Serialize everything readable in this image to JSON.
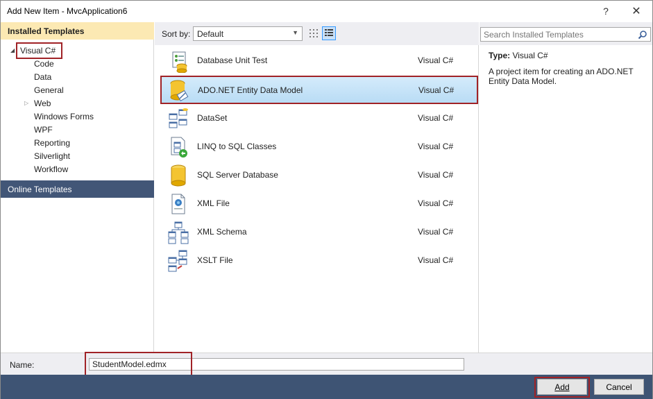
{
  "window": {
    "title": "Add New Item - MvcApplication6",
    "help_glyph": "?",
    "close_glyph": "✕"
  },
  "sidebar": {
    "installed_header": "Installed Templates",
    "root": {
      "label": "Visual C#",
      "expanded": true
    },
    "children": [
      {
        "label": "Code"
      },
      {
        "label": "Data"
      },
      {
        "label": "General"
      },
      {
        "label": "Web",
        "expander": "▷"
      },
      {
        "label": "Windows Forms"
      },
      {
        "label": "WPF"
      },
      {
        "label": "Reporting"
      },
      {
        "label": "Silverlight"
      },
      {
        "label": "Workflow"
      }
    ],
    "online_header": "Online Templates"
  },
  "sort": {
    "label": "Sort by:",
    "value": "Default"
  },
  "search": {
    "placeholder": "Search Installed Templates"
  },
  "templates": [
    {
      "name": "Database Unit Test",
      "lang": "Visual C#",
      "icon": "database-unit-test-icon",
      "selected": false
    },
    {
      "name": "ADO.NET Entity Data Model",
      "lang": "Visual C#",
      "icon": "entity-data-model-icon",
      "selected": true
    },
    {
      "name": "DataSet",
      "lang": "Visual C#",
      "icon": "dataset-icon",
      "selected": false
    },
    {
      "name": "LINQ to SQL Classes",
      "lang": "Visual C#",
      "icon": "linq-to-sql-icon",
      "selected": false
    },
    {
      "name": "SQL Server Database",
      "lang": "Visual C#",
      "icon": "sql-database-icon",
      "selected": false
    },
    {
      "name": "XML File",
      "lang": "Visual C#",
      "icon": "xml-file-icon",
      "selected": false
    },
    {
      "name": "XML Schema",
      "lang": "Visual C#",
      "icon": "xml-schema-icon",
      "selected": false
    },
    {
      "name": "XSLT File",
      "lang": "Visual C#",
      "icon": "xslt-file-icon",
      "selected": false
    }
  ],
  "details": {
    "type_label": "Type:",
    "type_value": "Visual C#",
    "description": "A project item for creating an ADO.NET Entity Data Model."
  },
  "footer": {
    "name_label": "Name:",
    "name_value": "StudentModel.edmx",
    "add_label": "Add",
    "cancel_label": "Cancel"
  },
  "colors": {
    "highlight_border": "#a02226",
    "installed_header_bg": "#fce9b3",
    "online_header_bg": "#425677",
    "button_bar_bg": "#3e5474",
    "selection_bg": "#c9e3f8"
  }
}
